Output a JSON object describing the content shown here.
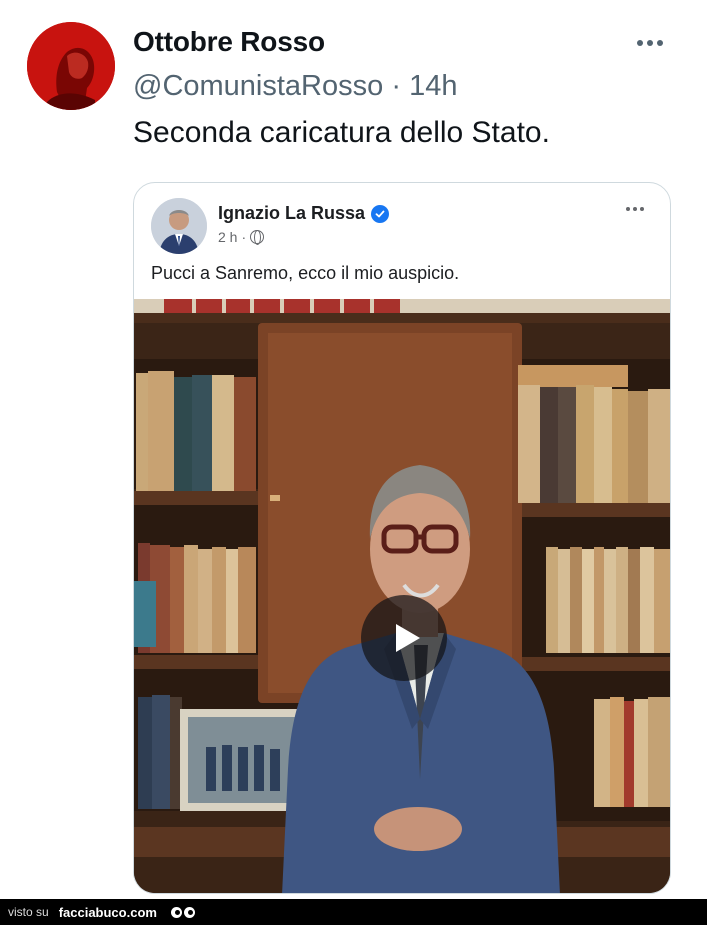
{
  "tweet": {
    "author_name": "Ottobre Rosso",
    "handle": "@ComunistaRosso",
    "separator": "·",
    "time": "14h",
    "text": "Seconda caricatura dello Stato.",
    "avatar_icon": "red-portrait-avatar",
    "more_icon": "more-horizontal-icon"
  },
  "embedded_post": {
    "author_name": "Ignazio La Russa",
    "verified": true,
    "time": "2 h",
    "separator": "·",
    "privacy_icon": "globe-icon",
    "text": "Pucci a Sanremo, ecco il mio auspicio.",
    "media_type": "video",
    "play_icon": "play-icon"
  },
  "footer": {
    "visto_label": "visto su",
    "site_label": "facciabuco.com"
  },
  "colors": {
    "brand_red": "#d0160f",
    "verified_blue": "#1877f2",
    "secondary_text": "#536471"
  }
}
